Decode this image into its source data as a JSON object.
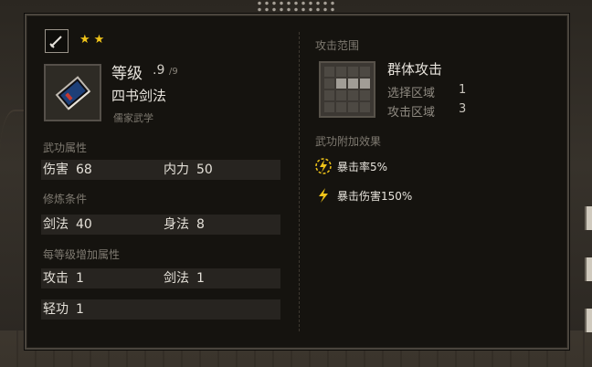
{
  "colors": {
    "accent_gold": "#f0c419",
    "text_main": "#e7e3dc",
    "text_muted": "#7f7a71",
    "panel_bg": "#15130f"
  },
  "header": {
    "type_icon": "sword-icon",
    "star_count": 2
  },
  "skill": {
    "level_label": "等级",
    "level": ".9",
    "level_max": "/9",
    "name": "四书剑法",
    "school": "儒家武学",
    "book_icon": "skill-book-icon"
  },
  "attributes": {
    "title": "武功属性",
    "damage": {
      "label": "伤害",
      "value": "68"
    },
    "internal": {
      "label": "内力",
      "value": "50"
    }
  },
  "requirements": {
    "title": "修炼条件",
    "sword": {
      "label": "剑法",
      "value": "40"
    },
    "body": {
      "label": "身法",
      "value": "8"
    }
  },
  "per_level": {
    "title": "每等级增加属性",
    "attack": {
      "label": "攻击",
      "value": "1"
    },
    "sword": {
      "label": "剑法",
      "value": "1"
    },
    "lightness": {
      "label": "轻功",
      "value": "1"
    }
  },
  "range": {
    "title": "攻击范围",
    "name": "群体攻击",
    "select_label": "选择区域",
    "select_value": "1",
    "attack_label": "攻击区域",
    "attack_value": "3"
  },
  "effects": {
    "title": "武功附加效果",
    "items": [
      {
        "label": "暴击率5%",
        "icon": "lightning-circle-icon"
      },
      {
        "label": "暴击伤害150%",
        "icon": "lightning-icon"
      }
    ]
  }
}
